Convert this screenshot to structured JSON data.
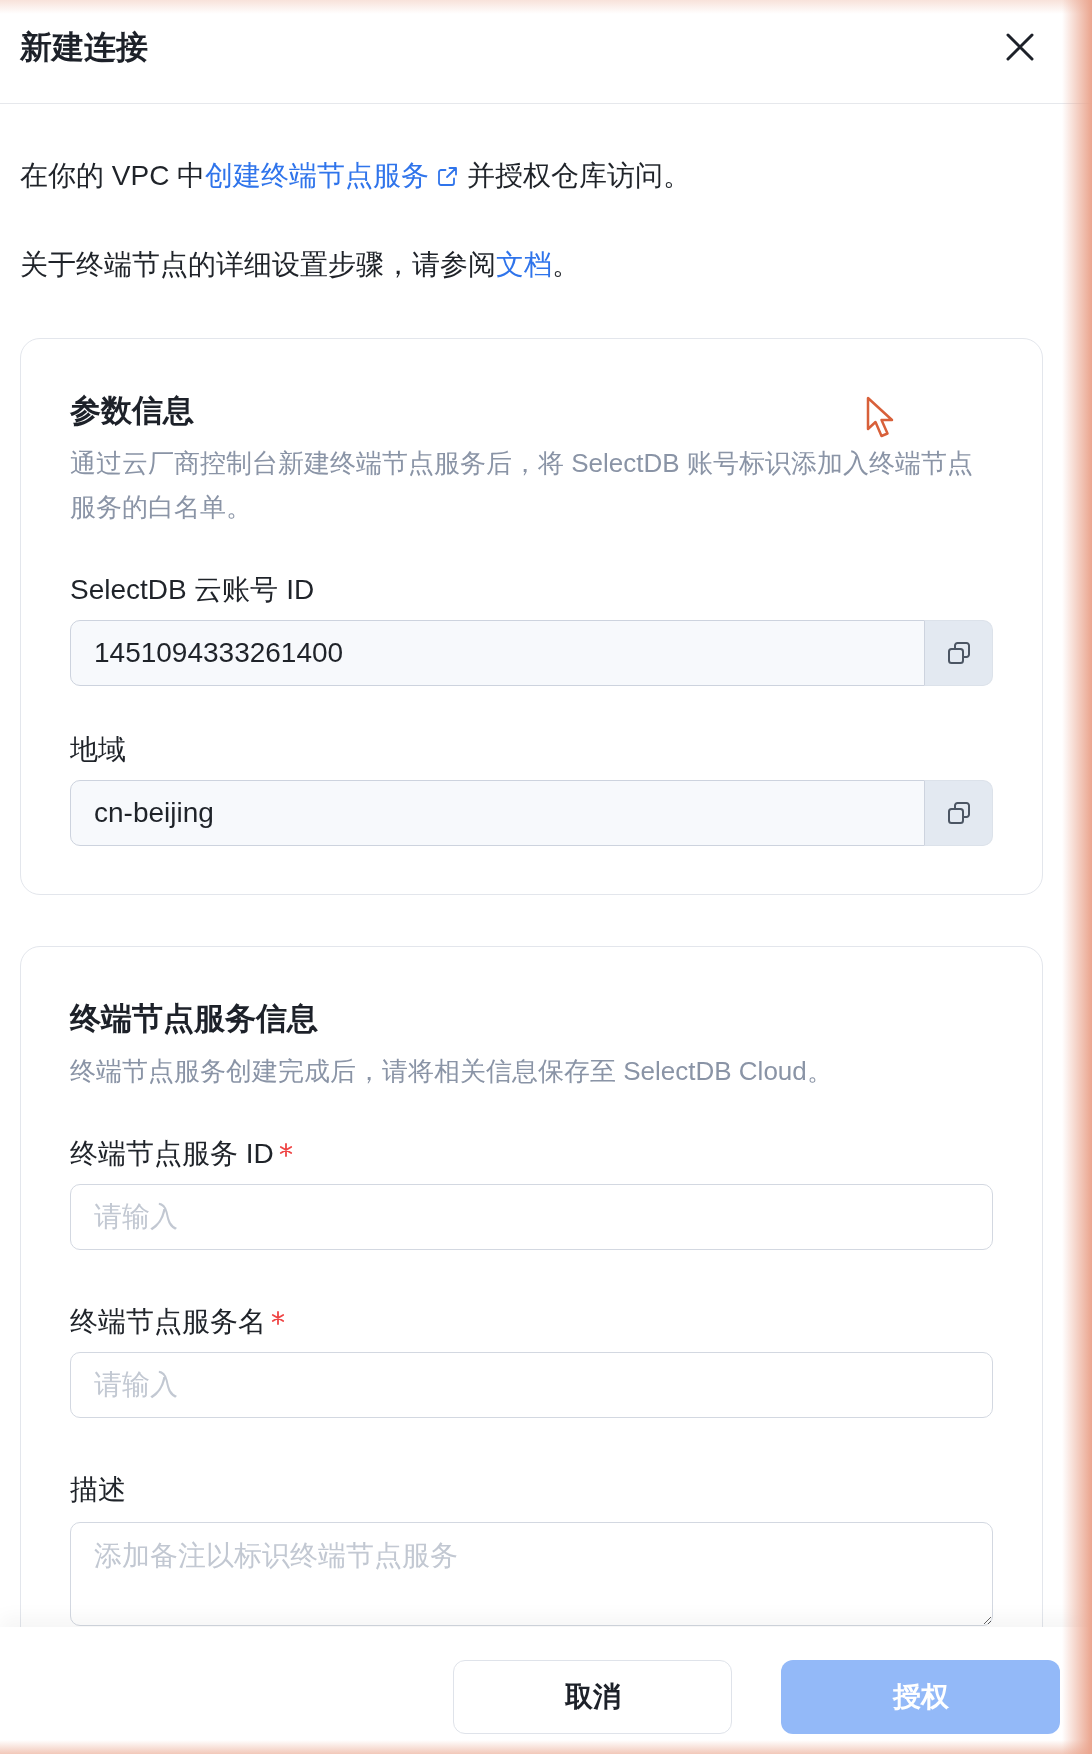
{
  "dialog": {
    "title": "新建连接"
  },
  "intro": [
    {
      "parts": [
        {
          "kind": "text",
          "text": "在你的 VPC 中"
        },
        {
          "kind": "link",
          "text": "创建终端节点服务",
          "external": true
        },
        {
          "kind": "text",
          "text": "并授权仓库访问。"
        }
      ]
    },
    {
      "parts": [
        {
          "kind": "text",
          "text": "关于终端节点的详细设置步骤，请参阅"
        },
        {
          "kind": "link",
          "text": "文档",
          "external": false
        },
        {
          "kind": "text",
          "text": "。"
        }
      ]
    }
  ],
  "sections": [
    {
      "title": "参数信息",
      "description": "通过云厂商控制台新建终端节点服务后，将 SelectDB 账号标识添加入终端节点服务的白名单。",
      "fields": [
        {
          "kind": "copy",
          "label": "SelectDB 云账号 ID",
          "required": false,
          "value": "1451094333261400"
        },
        {
          "kind": "copy",
          "label": "地域",
          "required": false,
          "value": "cn-beijing"
        }
      ]
    },
    {
      "title": "终端节点服务信息",
      "description": "终端节点服务创建完成后，请将相关信息保存至 SelectDB Cloud。",
      "fields": [
        {
          "kind": "input",
          "label": "终端节点服务 ID",
          "required": true,
          "placeholder": "请输入"
        },
        {
          "kind": "input",
          "label": "终端节点服务名",
          "required": true,
          "placeholder": "请输入"
        },
        {
          "kind": "textarea",
          "label": "描述",
          "required": false,
          "placeholder": "添加备注以标识终端节点服务"
        }
      ]
    }
  ],
  "footer": {
    "buttons": [
      {
        "label": "取消",
        "kind": "secondary",
        "disabled": false
      },
      {
        "label": "授权",
        "kind": "primary",
        "disabled": true
      }
    ]
  }
}
